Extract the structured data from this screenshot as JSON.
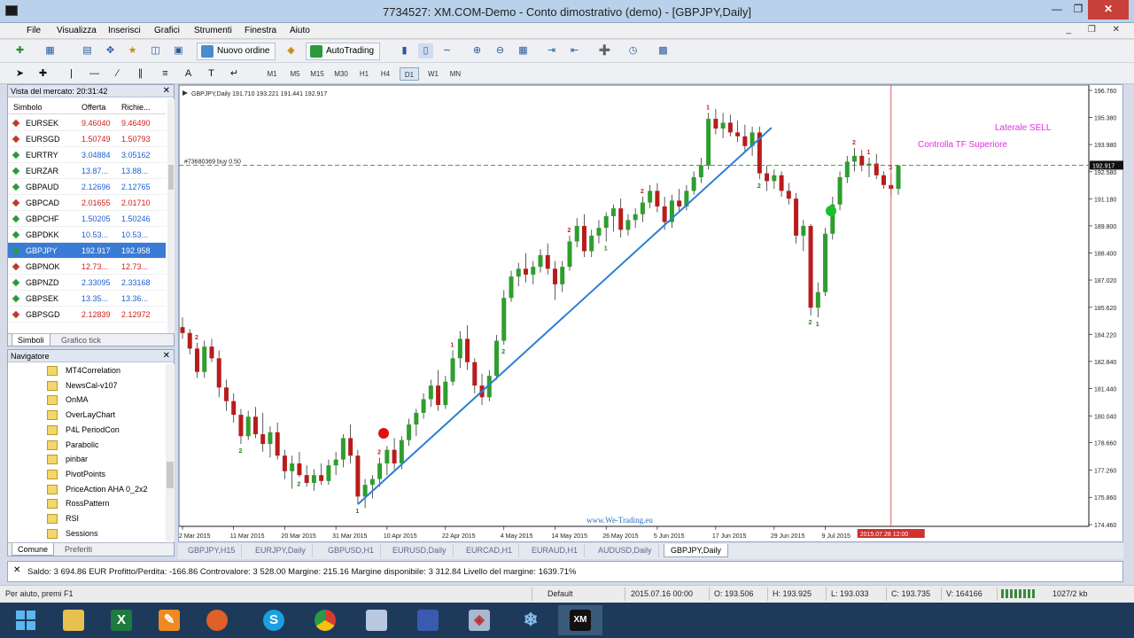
{
  "window": {
    "title": "7734527: XM.COM-Demo - Conto dimostrativo (demo) - [GBPJPY,Daily]"
  },
  "menu": [
    "File",
    "Visualizza",
    "Inserisci",
    "Grafici",
    "Strumenti",
    "Finestra",
    "Aiuto"
  ],
  "toolbar": {
    "new_order": "Nuovo ordine",
    "autotrading": "AutoTrading"
  },
  "timeframes": [
    "M1",
    "M5",
    "M15",
    "M30",
    "H1",
    "H4",
    "D1",
    "W1",
    "MN"
  ],
  "market_watch": {
    "title": "Vista del mercato: 20:31:42",
    "columns": [
      "Simbolo",
      "Offerta",
      "Richie..."
    ],
    "rows": [
      {
        "symbol": "EURSEK",
        "bid": "9.46040",
        "ask": "9.46490",
        "dir": "down"
      },
      {
        "symbol": "EURSGD",
        "bid": "1.50749",
        "ask": "1.50793",
        "dir": "down"
      },
      {
        "symbol": "EURTRY",
        "bid": "3.04884",
        "ask": "3.05162",
        "dir": "up"
      },
      {
        "symbol": "EURZAR",
        "bid": "13.87...",
        "ask": "13.88...",
        "dir": "up"
      },
      {
        "symbol": "GBPAUD",
        "bid": "2.12696",
        "ask": "2.12765",
        "dir": "up"
      },
      {
        "symbol": "GBPCAD",
        "bid": "2.01655",
        "ask": "2.01710",
        "dir": "down"
      },
      {
        "symbol": "GBPCHF",
        "bid": "1.50205",
        "ask": "1.50246",
        "dir": "up"
      },
      {
        "symbol": "GBPDKK",
        "bid": "10.53...",
        "ask": "10.53...",
        "dir": "up"
      },
      {
        "symbol": "GBPJPY",
        "bid": "192.917",
        "ask": "192.958",
        "dir": "up"
      },
      {
        "symbol": "GBPNOK",
        "bid": "12.73...",
        "ask": "12.73...",
        "dir": "down"
      },
      {
        "symbol": "GBPNZD",
        "bid": "2.33095",
        "ask": "2.33168",
        "dir": "up"
      },
      {
        "symbol": "GBPSEK",
        "bid": "13.35...",
        "ask": "13.36...",
        "dir": "up"
      },
      {
        "symbol": "GBPSGD",
        "bid": "2.12839",
        "ask": "2.12972",
        "dir": "down"
      }
    ],
    "tabs": [
      "Simboli",
      "Grafico tick"
    ]
  },
  "navigator": {
    "title": "Navigatore",
    "items": [
      "MT4Correlation",
      "NewsCal-v107",
      "OnMA",
      "OverLayChart",
      "P4L PeriodCon",
      "Parabolic",
      "pinbar",
      "PivotPoints",
      "PriceAction AHA 0_2x2",
      "RossPattern",
      "RSI",
      "Sessions"
    ],
    "tabs": [
      "Comune",
      "Preferiti"
    ]
  },
  "chart": {
    "header": "GBPJPY,Daily  191.710 193.221 191.441 192.917",
    "order_line_label": "#73680369 buy 0.50",
    "annotation_sell": "Laterale SELL",
    "annotation_tf": "Controlla TF Superiore",
    "watermark": "www.We-Trading.eu",
    "current_price": "192.917",
    "current_date_label": "2015.07.28 12:00",
    "colors": {
      "bull": "#2e9e2e",
      "bear": "#b81c1c",
      "trendline": "#2a7fd4",
      "order_line": "#3c8c3c",
      "vline": "#d05050",
      "annotation": "#e030e0"
    }
  },
  "chart_data": {
    "type": "candlestick",
    "title": "GBPJPY,Daily",
    "y_ticks": [
      "196.760",
      "195.380",
      "193.980",
      "192.580",
      "191.180",
      "189.800",
      "188.400",
      "187.020",
      "185.620",
      "184.220",
      "182.840",
      "181.440",
      "180.040",
      "178.660",
      "177.260",
      "175.860",
      "174.460"
    ],
    "x_ticks": [
      "2 Mar 2015",
      "11 Mar 2015",
      "20 Mar 2015",
      "31 Mar 2015",
      "10 Apr 2015",
      "22 Apr 2015",
      "4 May 2015",
      "14 May 2015",
      "26 May 2015",
      "5 Jun 2015",
      "17 Jun 2015",
      "29 Jun 2015",
      "9 Jul 2015"
    ],
    "y_range": [
      174.46,
      196.76
    ],
    "order_line_price": 192.917,
    "candles": [
      [
        184.6,
        185.1,
        184.0,
        184.3
      ],
      [
        184.3,
        184.5,
        183.2,
        183.5
      ],
      [
        183.5,
        183.8,
        182.0,
        182.3
      ],
      [
        182.3,
        183.9,
        182.0,
        183.6
      ],
      [
        183.6,
        184.0,
        182.8,
        183.0
      ],
      [
        183.0,
        183.4,
        181.0,
        181.5
      ],
      [
        181.5,
        181.9,
        180.3,
        180.8
      ],
      [
        180.8,
        181.2,
        179.7,
        180.1
      ],
      [
        180.1,
        180.4,
        178.6,
        179.0
      ],
      [
        179.0,
        180.3,
        178.8,
        180.0
      ],
      [
        180.0,
        180.5,
        178.9,
        179.1
      ],
      [
        179.1,
        180.2,
        178.2,
        178.6
      ],
      [
        178.6,
        179.5,
        177.9,
        179.2
      ],
      [
        179.2,
        179.7,
        177.8,
        178.0
      ],
      [
        178.0,
        178.3,
        176.8,
        177.2
      ],
      [
        177.2,
        178.0,
        176.3,
        177.6
      ],
      [
        177.6,
        178.2,
        176.9,
        177.0
      ],
      [
        177.0,
        177.5,
        176.4,
        176.6
      ],
      [
        176.6,
        177.3,
        176.2,
        177.0
      ],
      [
        177.0,
        177.6,
        176.5,
        176.7
      ],
      [
        176.7,
        177.8,
        176.5,
        177.5
      ],
      [
        177.5,
        178.2,
        177.0,
        177.8
      ],
      [
        177.8,
        179.1,
        177.4,
        178.9
      ],
      [
        178.9,
        179.6,
        177.6,
        178.0
      ],
      [
        178.0,
        178.3,
        175.5,
        175.9
      ],
      [
        175.9,
        176.8,
        175.3,
        176.5
      ],
      [
        176.5,
        177.0,
        175.8,
        176.8
      ],
      [
        176.8,
        177.9,
        176.4,
        177.6
      ],
      [
        177.6,
        178.5,
        177.0,
        178.3
      ],
      [
        178.3,
        178.9,
        177.3,
        177.6
      ],
      [
        177.6,
        179.0,
        177.3,
        178.8
      ],
      [
        178.8,
        179.9,
        178.5,
        179.6
      ],
      [
        179.6,
        180.4,
        179.0,
        180.2
      ],
      [
        180.2,
        181.2,
        179.9,
        180.9
      ],
      [
        180.9,
        181.9,
        180.5,
        181.6
      ],
      [
        181.6,
        182.4,
        180.3,
        180.6
      ],
      [
        180.6,
        182.1,
        180.4,
        181.8
      ],
      [
        181.8,
        183.4,
        181.6,
        183.0
      ],
      [
        183.0,
        184.4,
        182.5,
        184.0
      ],
      [
        184.0,
        184.7,
        182.4,
        182.8
      ],
      [
        182.8,
        183.0,
        181.2,
        181.6
      ],
      [
        181.6,
        182.2,
        180.6,
        181.0
      ],
      [
        181.0,
        182.4,
        180.8,
        182.1
      ],
      [
        182.1,
        184.2,
        181.9,
        183.9
      ],
      [
        183.9,
        186.5,
        183.7,
        186.1
      ],
      [
        186.1,
        187.5,
        185.9,
        187.2
      ],
      [
        187.2,
        187.9,
        186.7,
        187.6
      ],
      [
        187.6,
        188.4,
        186.9,
        187.3
      ],
      [
        187.3,
        188.0,
        186.8,
        187.7
      ],
      [
        187.7,
        188.6,
        187.4,
        188.3
      ],
      [
        188.3,
        188.9,
        187.3,
        187.6
      ],
      [
        187.6,
        188.0,
        186.0,
        186.8
      ],
      [
        186.8,
        188.0,
        186.4,
        187.7
      ],
      [
        187.7,
        189.3,
        187.5,
        189.0
      ],
      [
        189.0,
        190.2,
        188.7,
        189.8
      ],
      [
        189.8,
        190.4,
        188.2,
        188.5
      ],
      [
        188.5,
        189.6,
        188.2,
        189.3
      ],
      [
        189.3,
        190.1,
        188.9,
        189.7
      ],
      [
        189.7,
        190.5,
        189.0,
        190.3
      ],
      [
        190.3,
        190.9,
        189.5,
        190.7
      ],
      [
        190.7,
        191.2,
        189.2,
        189.6
      ],
      [
        189.6,
        190.4,
        189.3,
        190.1
      ],
      [
        190.1,
        190.7,
        189.7,
        190.4
      ],
      [
        190.4,
        191.3,
        190.0,
        191.0
      ],
      [
        191.0,
        191.9,
        190.7,
        191.6
      ],
      [
        191.6,
        192.0,
        190.5,
        190.8
      ],
      [
        190.8,
        191.3,
        189.6,
        190.0
      ],
      [
        190.0,
        191.4,
        189.7,
        191.1
      ],
      [
        191.1,
        191.7,
        190.5,
        190.8
      ],
      [
        190.8,
        191.9,
        190.6,
        191.6
      ],
      [
        191.6,
        192.6,
        191.4,
        192.3
      ],
      [
        192.3,
        193.3,
        192.0,
        192.9
      ],
      [
        192.9,
        195.6,
        192.7,
        195.3
      ],
      [
        195.3,
        195.8,
        194.5,
        194.8
      ],
      [
        194.8,
        195.6,
        194.3,
        195.1
      ],
      [
        195.1,
        195.5,
        194.4,
        194.6
      ],
      [
        194.6,
        195.2,
        194.1,
        194.4
      ],
      [
        194.4,
        195.0,
        193.6,
        193.9
      ],
      [
        193.9,
        194.9,
        193.4,
        194.6
      ],
      [
        194.6,
        194.9,
        192.2,
        192.5
      ],
      [
        192.5,
        192.9,
        191.6,
        192.1
      ],
      [
        192.1,
        192.7,
        191.7,
        192.4
      ],
      [
        192.4,
        192.6,
        191.3,
        191.6
      ],
      [
        191.6,
        192.0,
        190.9,
        191.2
      ],
      [
        191.2,
        191.5,
        188.9,
        189.3
      ],
      [
        189.3,
        190.1,
        188.5,
        189.8
      ],
      [
        189.8,
        189.9,
        185.2,
        185.6
      ],
      [
        185.6,
        186.9,
        185.1,
        186.4
      ],
      [
        186.4,
        189.7,
        186.2,
        189.4
      ],
      [
        189.4,
        191.3,
        189.1,
        190.9
      ],
      [
        190.9,
        192.6,
        190.6,
        192.3
      ],
      [
        192.3,
        193.4,
        192.0,
        193.1
      ],
      [
        193.1,
        193.8,
        192.6,
        193.4
      ],
      [
        193.4,
        193.7,
        192.6,
        192.9
      ],
      [
        192.9,
        193.3,
        192.3,
        193.0
      ],
      [
        193.0,
        193.5,
        192.2,
        192.4
      ],
      [
        192.4,
        192.6,
        191.7,
        191.9
      ],
      [
        191.9,
        192.5,
        191.3,
        191.7
      ],
      [
        191.7,
        192.5,
        191.4,
        192.9
      ]
    ],
    "fractal_marks": [
      [
        2,
        "2",
        "up"
      ],
      [
        8,
        "2",
        "dn"
      ],
      [
        16,
        "2",
        "dn"
      ],
      [
        24,
        "1",
        "dn"
      ],
      [
        27,
        "2",
        "up"
      ],
      [
        37,
        "1",
        "up"
      ],
      [
        44,
        "2",
        "dn"
      ],
      [
        53,
        "2",
        "up"
      ],
      [
        58,
        "1",
        "dn"
      ],
      [
        63,
        "2",
        "up"
      ],
      [
        72,
        "1",
        "up"
      ],
      [
        79,
        "2",
        "dn"
      ],
      [
        86,
        "2",
        "dn"
      ],
      [
        87,
        "1",
        "dn"
      ],
      [
        92,
        "2",
        "up"
      ],
      [
        94,
        "1",
        "up"
      ],
      [
        97,
        "3",
        "up"
      ]
    ]
  },
  "chart_tabs": [
    "GBPJPY,H15",
    "EURJPY,Daily",
    "GBPUSD,H1",
    "EURUSD,Daily",
    "EURCAD,H1",
    "EURAUD,H1",
    "AUDUSD,Daily",
    "GBPJPY,Daily"
  ],
  "terminal": {
    "balance_line": "Saldo: 3 694.86 EUR  Profitto/Perdita: -166.86  Controvalore: 3 528.00  Margine: 215.16  Margine disponibile: 3 312.84  Livello del margine: 1639.71%"
  },
  "statusbar": {
    "help": "Per aiuto, premi F1",
    "profile": "Default",
    "datetime": "2015.07.16 00:00",
    "open": "O: 193.506",
    "high": "H: 193.925",
    "low": "L: 193.033",
    "close": "C: 193.735",
    "volume": "V: 164166",
    "traffic": "1027/2 kb"
  },
  "taskbar": [
    "start",
    "file-explorer",
    "excel",
    "pencil-app",
    "firefox",
    "skype",
    "chrome",
    "document",
    "network",
    "paint",
    "snowflake",
    "xm-terminal"
  ],
  "taskbar_labels": {
    "skype": "S",
    "excel": "X",
    "xm": "XM"
  }
}
